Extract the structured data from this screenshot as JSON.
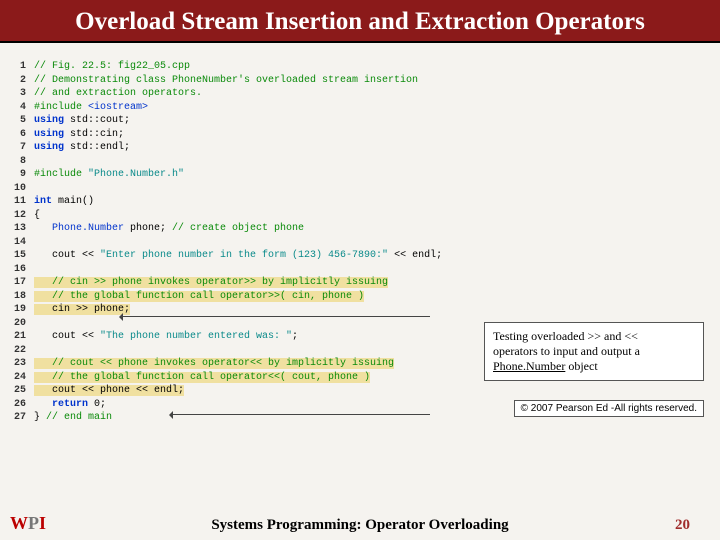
{
  "title": "Overload Stream Insertion and Extraction Operators",
  "code": {
    "l1": "// Fig. 22.5: fig22_05.cpp",
    "l2": "// Demonstrating class PhoneNumber's overloaded stream insertion",
    "l3": "// and extraction operators.",
    "l4a": "#include ",
    "l4b": "<iostream>",
    "l5a": "using",
    "l5b": " std::cout;",
    "l6a": "using",
    "l6b": " std::cin;",
    "l7a": "using",
    "l7b": " std::endl;",
    "l9a": "#include ",
    "l9b": "\"Phone.Number.h\"",
    "l11a": "int",
    "l11b": " main()",
    "l12": "{",
    "l13a": "   Phone.Number",
    "l13b": " phone; ",
    "l13c": "// create object phone",
    "l15a": "   cout << ",
    "l15b": "\"Enter phone number in the form (123) 456-7890:\"",
    "l15c": " << endl;",
    "l17": "   // cin >> phone invokes operator>> by implicitly issuing",
    "l18": "   // the global function call operator>>( cin, phone )",
    "l19": "   cin >> phone;",
    "l21a": "   cout << ",
    "l21b": "\"The phone number entered was: \"",
    "l21c": ";",
    "l23": "   // cout << phone invokes operator<< by implicitly issuing",
    "l24": "   // the global function call operator<<( cout, phone )",
    "l25": "   cout << phone << endl;",
    "l26a": "   return",
    "l26b": " 0;",
    "l27a": "} ",
    "l27b": "// end main"
  },
  "note": {
    "line1": "Testing overloaded >> and <<",
    "line2": "operators to input and output a",
    "obj": "Phone.Number",
    "line3": " object"
  },
  "copyright": "© 2007 Pearson Ed -All rights reserved.",
  "footer": "Systems Programming:   Operator Overloading",
  "page": "20",
  "logo": {
    "w": "W",
    "p": "P",
    "i": "I"
  }
}
